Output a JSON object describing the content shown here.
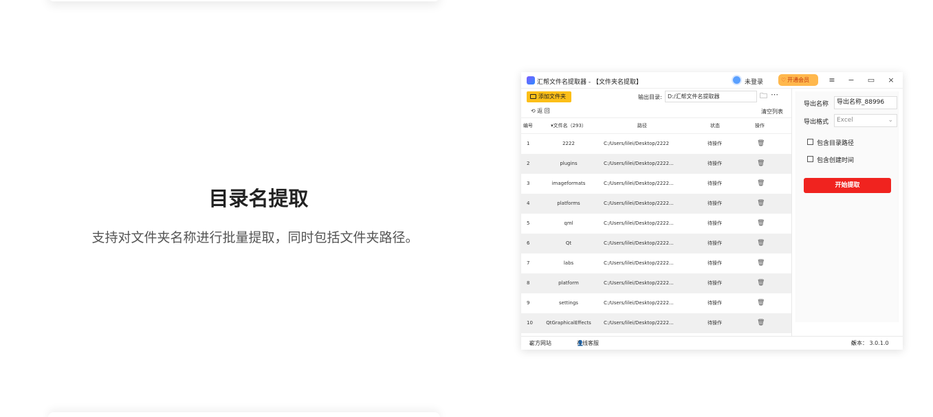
{
  "page": {
    "title": "目录名提取",
    "description": "支持对文件夹名称进行批量提取，同时包括文件夹路径。"
  },
  "app": {
    "title": "汇帮文件名提取器 - 【文件夹名提取】",
    "login_label": "未登录",
    "vip_label": "开通会员",
    "window_buttons": {
      "menu": "≡",
      "minimize": "−",
      "maximize": "▭",
      "close": "×"
    },
    "toolbar": {
      "add_folder_label": "添加文件夹",
      "output_dir_label": "输出目录:",
      "output_dir_value": "D:/汇帮文件名提取器",
      "back_label": "返 回",
      "clear_label": "清空列表"
    },
    "table": {
      "headers": {
        "no": "编号",
        "name": "▾文件名（293）",
        "path": "路径",
        "status": "状态",
        "op": "操作"
      },
      "rows": [
        {
          "no": "1",
          "name": "2222",
          "path": "C:/Users/lilei/Desktop/2222",
          "status": "待操作"
        },
        {
          "no": "2",
          "name": "plugins",
          "path": "C:/Users/lilei/Desktop/2222...",
          "status": "待操作"
        },
        {
          "no": "3",
          "name": "imageformats",
          "path": "C:/Users/lilei/Desktop/2222...",
          "status": "待操作"
        },
        {
          "no": "4",
          "name": "platforms",
          "path": "C:/Users/lilei/Desktop/2222...",
          "status": "待操作"
        },
        {
          "no": "5",
          "name": "qml",
          "path": "C:/Users/lilei/Desktop/2222...",
          "status": "待操作"
        },
        {
          "no": "6",
          "name": "Qt",
          "path": "C:/Users/lilei/Desktop/2222...",
          "status": "待操作"
        },
        {
          "no": "7",
          "name": "labs",
          "path": "C:/Users/lilei/Desktop/2222...",
          "status": "待操作"
        },
        {
          "no": "8",
          "name": "platform",
          "path": "C:/Users/lilei/Desktop/2222...",
          "status": "待操作"
        },
        {
          "no": "9",
          "name": "settings",
          "path": "C:/Users/lilei/Desktop/2222...",
          "status": "待操作"
        },
        {
          "no": "10",
          "name": "QtGraphicalEffects",
          "path": "C:/Users/lilei/Desktop/2222...",
          "status": "待操作"
        }
      ]
    },
    "right_panel": {
      "export_name_label": "导出名称",
      "export_name_value": "导出名称_88996",
      "export_format_label": "导出格式",
      "export_format_value": "Excel",
      "include_dir_path": "包含目录路径",
      "include_create_time": "包含创建时间",
      "start_button": "开始提取"
    },
    "footer": {
      "website": "官方网站",
      "support": "在线客服",
      "version": "版本： 3.0.1.0"
    }
  }
}
